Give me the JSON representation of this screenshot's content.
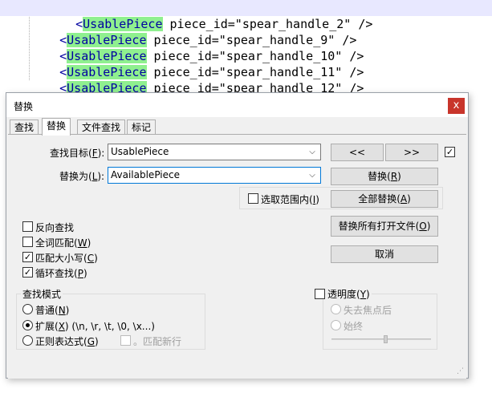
{
  "editor": {
    "lines": [
      {
        "indent": "    ",
        "lt": "<",
        "tag": "UsablePiece",
        "rest": " piece_id=\"spear_handle_2\" />"
      },
      {
        "indent": "  ",
        "lt": "<",
        "tag": "UsablePiece",
        "rest": " piece_id=\"spear_handle_9\" />"
      },
      {
        "indent": "  ",
        "lt": "<",
        "tag": "UsablePiece",
        "rest": " piece_id=\"spear_handle_10\" />"
      },
      {
        "indent": "  ",
        "lt": "<",
        "tag": "UsablePiece",
        "rest": " piece_id=\"spear_handle_11\" />"
      },
      {
        "indent": "  ",
        "lt": "<",
        "tag": "UsablePiece",
        "rest": " piece_id=\"spear_handle_12\" />"
      }
    ]
  },
  "dialog": {
    "title": "替换",
    "close_glyph": "x",
    "tabs": [
      "查找",
      "替换",
      "文件查找",
      "标记"
    ],
    "find_label": "查找目标(",
    "find_key": "F",
    "find_label_end": "):",
    "find_value": "UsablePiece",
    "replace_label": "替换为(",
    "replace_key": "L",
    "replace_label_end": "):",
    "replace_value": "AvailablePiece",
    "dropdown_glyph": "⌵",
    "prev_button": "<<",
    "next_button": ">>",
    "in_selection": {
      "label": "选取范围内(",
      "key": "I",
      "end": ")",
      "checked": false
    },
    "replace_button": {
      "label": "替换(",
      "key": "R",
      "end": ")"
    },
    "replace_all_button": {
      "label": "全部替换(",
      "key": "A",
      "end": ")"
    },
    "replace_all_open_button": {
      "label": "替换所有打开文件(",
      "key": "O",
      "end": ")"
    },
    "cancel_button": "取消",
    "options": [
      {
        "label": "反向查找",
        "key": "",
        "checked": false
      },
      {
        "label": "全词匹配(",
        "key": "W",
        "end": ")",
        "checked": false
      },
      {
        "label": "匹配大小写(",
        "key": "C",
        "end": ")",
        "checked": true
      },
      {
        "label": "循环查找(",
        "key": "P",
        "end": ")",
        "checked": true
      }
    ],
    "search_mode": {
      "title": "查找模式",
      "normal": {
        "label": "普通(",
        "key": "N",
        "end": ")",
        "selected": false
      },
      "extended": {
        "label": "扩展(",
        "key": "X",
        "end": ") (\\n, \\r, \\t, \\0, \\x...)",
        "selected": true
      },
      "regex": {
        "label": "正则表达式(",
        "key": "G",
        "end": ")",
        "selected": false
      },
      "dot_newline": "。匹配新行"
    },
    "transparency": {
      "label": "透明度(",
      "key": "Y",
      "end": ")",
      "checked": false,
      "on_lose_focus": "失去焦点后",
      "always": "始终",
      "level": 0.55
    },
    "checkmark": "✓",
    "colors": {
      "highlight": "#8ff08f",
      "close": "#c8352b",
      "focus": "#0078d7"
    }
  }
}
